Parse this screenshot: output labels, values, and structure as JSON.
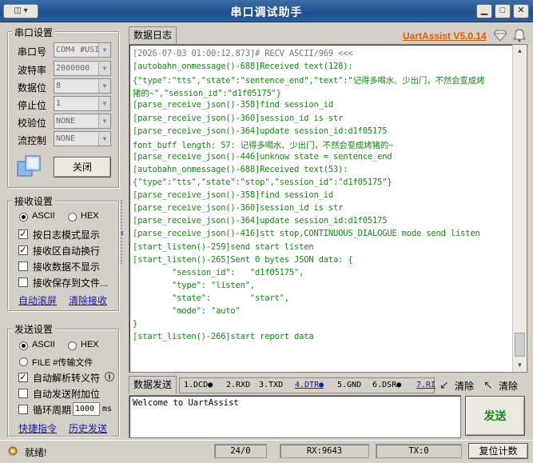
{
  "window": {
    "title": "串口调试助手",
    "sysmenu": "◫ ▾",
    "buttons": {
      "minimize": "▁",
      "maximize": "□",
      "close": "✕"
    }
  },
  "serial_settings": {
    "group_title": "串口设置",
    "port_label": "串口号",
    "port_value": "COM4 #USI",
    "baud_label": "波特率",
    "baud_value": "2000000",
    "databits_label": "数据位",
    "databits_value": "8",
    "stopbits_label": "停止位",
    "stopbits_value": "1",
    "parity_label": "校验位",
    "parity_value": "NONE",
    "flow_label": "流控制",
    "flow_value": "NONE",
    "close_button": "关闭"
  },
  "receive_settings": {
    "group_title": "接收设置",
    "ascii_label": "ASCII",
    "hex_label": "HEX",
    "options": [
      {
        "label": "按日志模式显示",
        "checked": true,
        "mark": "✓"
      },
      {
        "label": "接收区自动换行",
        "checked": true,
        "mark": "✓"
      },
      {
        "label": "接收数据不显示",
        "checked": false,
        "mark": ""
      },
      {
        "label": "接收保存到文件...",
        "checked": false,
        "mark": ""
      }
    ],
    "auto_scroll_link": "自动滚屏",
    "clear_receive_link": "清除接收"
  },
  "send_settings": {
    "group_title": "发送设置",
    "ascii_label": "ASCII",
    "hex_label": "HEX",
    "file_label": "FILE #传输文件",
    "auto_escape_label": "自动解析转义符",
    "auto_escape_mark": "✓",
    "append_label": "自动发送附加位",
    "cycle_label": "循环周期",
    "cycle_value": "1000",
    "cycle_unit": "ms",
    "shortcut_link": "快捷指令",
    "history_link": "历史发送"
  },
  "log": {
    "tab_label": "数据日志",
    "brand": "UartAssist V5.0.14",
    "lines": [
      "[2026-07-03 01:00:12.873]# RECV ASCII/969 <<<",
      "[autobahn_onmessage()-688]Received text(128):",
      "{\"type\":\"tts\",\"state\":\"sentence_end\",\"text\":\"记得多喝水、少出门，不然会变成烤",
      "猪的~\",\"session_id\":\"d1f05175\"}",
      "[parse_receive_json()-358]find session_id",
      "[parse_receive_json()-360]session_id is str",
      "[parse_receive_json()-364]update session_id:d1f05175",
      "font_buff length: 57: 记得多喝水、少出门，不然会变成烤猪的~",
      "[parse_receive_json()-446]unknow state = sentence_end",
      "[autobahn_onmessage()-688]Received text(53):",
      "{\"type\":\"tts\",\"state\":\"stop\",\"session_id\":\"d1f05175\"}",
      "[parse_receive_json()-358]find session_id",
      "[parse_receive_json()-360]session_id is str",
      "[parse_receive_json()-364]update session_id:d1f05175",
      "[parse_receive_json()-416]stt stop,CONTINUOUS_DIALOGUE mode send listen",
      "[start_listen()-259]send start listen",
      "[start_listen()-265]Sent 0 bytes JSON data: {",
      "        \"session_id\":   \"d1f05175\",",
      "        \"type\": \"listen\",",
      "        \"state\":        \"start\",",
      "        \"mode\": \"auto\"",
      "}",
      "[start_listen()-266]start report data"
    ]
  },
  "send_area": {
    "tab_label": "数据发送",
    "pins": [
      "1.DCD●",
      "2.RXD",
      "3.TXD",
      "4.DTR●",
      "5.GND",
      "6.DSR●",
      "7.RI"
    ],
    "clear_label_1": "清除",
    "clear_label_2": "清除",
    "text": "Welcome to UartAssist",
    "send_button": "发送"
  },
  "status": {
    "ready": "就绪!",
    "counter": "24/0",
    "rx": "RX:9643",
    "tx": "TX:0",
    "reset": "复位计数"
  }
}
